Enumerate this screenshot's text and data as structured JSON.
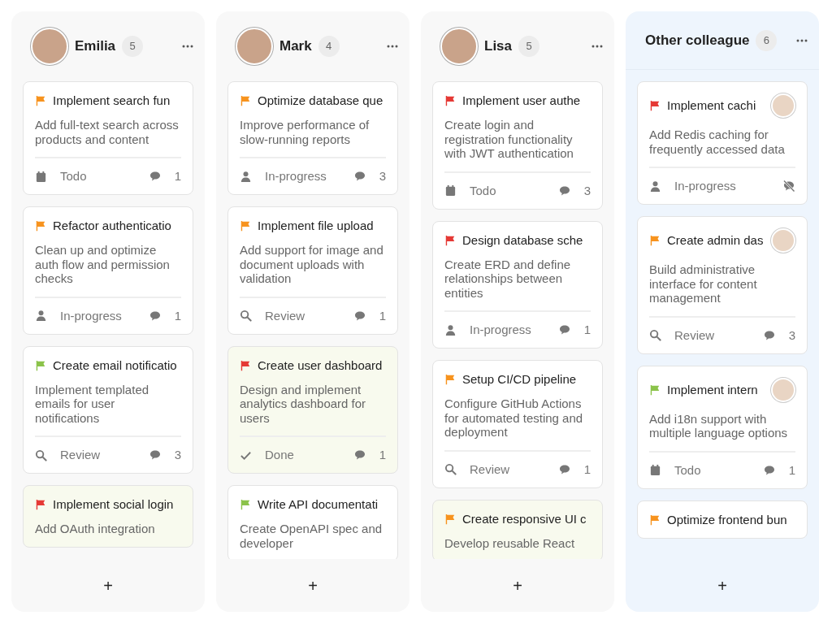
{
  "columns": [
    {
      "title": "Emilia",
      "avatar": true,
      "count": "5",
      "tinted": false,
      "cards": [
        {
          "color": "#f7931e",
          "title": "Implement search fun",
          "description": "Add full-text search across products and content",
          "kind": "todo",
          "status": "Todo",
          "comments": "1",
          "highlighted": false
        },
        {
          "color": "#f7931e",
          "title": "Refactor authenticatio",
          "description": "Clean up and optimize auth flow and permission checks",
          "kind": "inprogress",
          "status": "In-progress",
          "comments": "1",
          "highlighted": false
        },
        {
          "color": "#8bc34a",
          "title": "Create email notificatio",
          "description": "Implement templated emails for user notifications",
          "kind": "review",
          "status": "Review",
          "comments": "3",
          "highlighted": false
        },
        {
          "color": "#e53935",
          "title": "Implement social login",
          "description": "Add OAuth integration",
          "highlighted": true
        }
      ]
    },
    {
      "title": "Mark",
      "avatar": true,
      "count": "4",
      "tinted": false,
      "cards": [
        {
          "color": "#f7931e",
          "title": "Optimize database que",
          "description": "Improve performance of slow-running reports",
          "kind": "inprogress",
          "status": "In-progress",
          "comments": "3",
          "highlighted": false
        },
        {
          "color": "#f7931e",
          "title": "Implement file upload",
          "description": "Add support for image and document uploads with validation",
          "kind": "review",
          "status": "Review",
          "comments": "1",
          "highlighted": false
        },
        {
          "color": "#e53935",
          "title": "Create user dashboard",
          "description": "Design and implement analytics dashboard for users",
          "kind": "done",
          "status": "Done",
          "comments": "1",
          "highlighted": true
        },
        {
          "color": "#8bc34a",
          "title": "Write API documentati",
          "description": "Create OpenAPI spec and developer",
          "highlighted": false
        }
      ]
    },
    {
      "title": "Lisa",
      "avatar": true,
      "count": "5",
      "tinted": false,
      "cards": [
        {
          "color": "#e53935",
          "title": "Implement user authe",
          "description": "Create login and registration functionality with JWT authentication",
          "kind": "todo",
          "status": "Todo",
          "comments": "3",
          "highlighted": false
        },
        {
          "color": "#e53935",
          "title": "Design database sche",
          "description": "Create ERD and define relationships between entities",
          "kind": "inprogress",
          "status": "In-progress",
          "comments": "1",
          "highlighted": false
        },
        {
          "color": "#f7931e",
          "title": "Setup CI/CD pipeline",
          "description": "Configure GitHub Actions for automated testing and deployment",
          "kind": "review",
          "status": "Review",
          "comments": "1",
          "highlighted": false
        },
        {
          "color": "#f7931e",
          "title": "Create responsive UI c",
          "description": "Develop reusable React",
          "highlighted": true
        }
      ]
    },
    {
      "title": "Other colleague",
      "avatar": false,
      "count": "6",
      "tinted": true,
      "cards": [
        {
          "color": "#e53935",
          "title": "Implement cachi",
          "assignee_avatar": true,
          "description": "Add Redis caching for frequently accessed data",
          "kind": "inprogress",
          "status": "In-progress",
          "comments_off": true,
          "highlighted": false
        },
        {
          "color": "#f7931e",
          "title": "Create admin das",
          "assignee_avatar": true,
          "description": "Build administrative interface for content management",
          "kind": "review",
          "status": "Review",
          "comments": "3",
          "highlighted": false
        },
        {
          "color": "#8bc34a",
          "title": "Implement intern",
          "assignee_avatar": true,
          "description": "Add i18n support with multiple language options",
          "kind": "todo",
          "status": "Todo",
          "comments": "1",
          "highlighted": false
        },
        {
          "color": "#f7931e",
          "title": "Optimize frontend bun",
          "highlighted": false
        }
      ]
    }
  ],
  "add_label": "+"
}
